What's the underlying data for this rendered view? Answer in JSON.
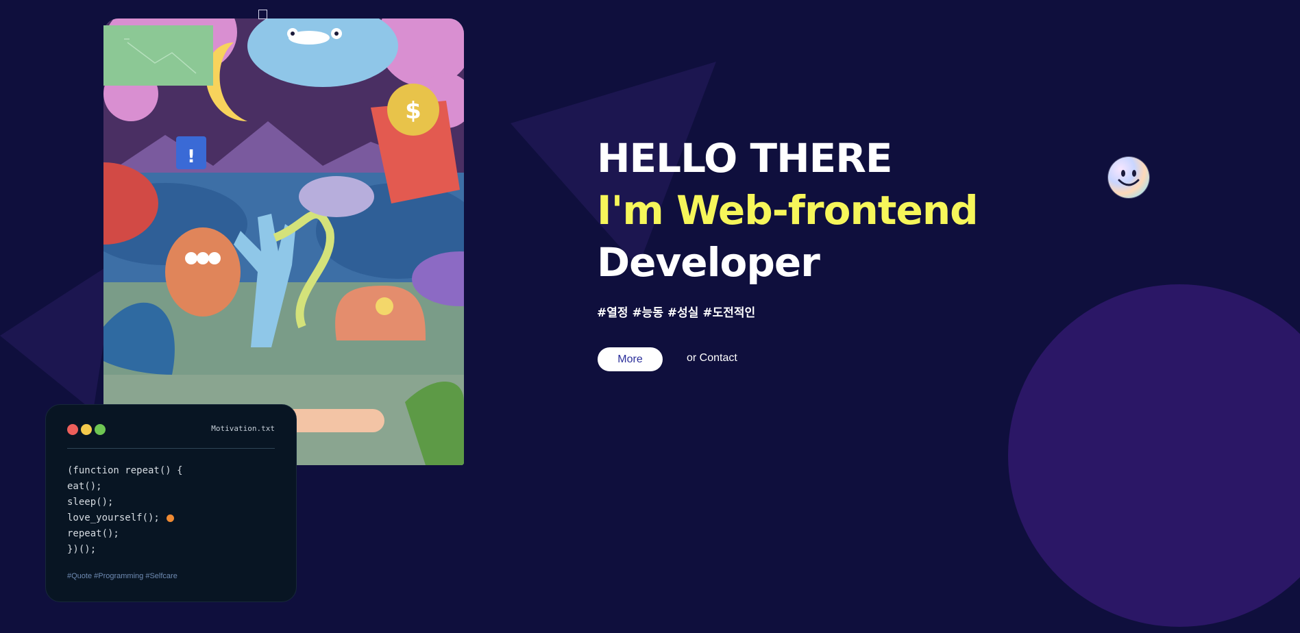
{
  "hero": {
    "line1": "HELLO THERE",
    "line2": "I'm Web-frontend",
    "line3": "Developer",
    "hashtags": "#열정 #능동 #성실 #도전적인",
    "more_label": "More",
    "contact_label": "or Contact"
  },
  "code_card": {
    "file_name": "Motivation.txt",
    "lines": [
      "(function repeat() {",
      "eat();",
      "sleep();",
      "love_yourself();",
      "repeat();",
      "})();"
    ],
    "tags": "#Quote #Programming #Selfcare"
  },
  "colors": {
    "background": "#0f0f3d",
    "accent_yellow": "#f6f65a",
    "button_text": "#2a2e9a",
    "code_card_bg": "#081523"
  },
  "icons": {
    "smiley": "smiley-sticker-icon",
    "window_dots": [
      "red-dot",
      "yellow-dot",
      "green-dot"
    ]
  }
}
